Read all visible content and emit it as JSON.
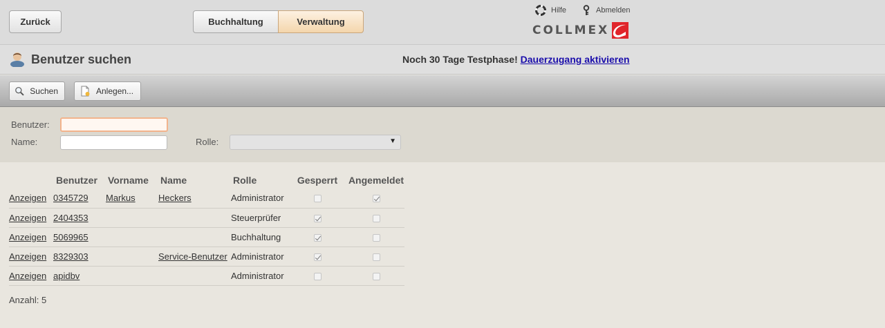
{
  "topbar": {
    "back_label": "Zurück",
    "tabs": [
      {
        "label": "Buchhaltung",
        "active": false
      },
      {
        "label": "Verwaltung",
        "active": true
      }
    ],
    "help_label": "Hilfe",
    "logout_label": "Abmelden",
    "logo_text": "COLLMEX",
    "logo_color": "#e0252b"
  },
  "titlebar": {
    "title": "Benutzer suchen",
    "trial_text": "Noch 30 Tage Testphase!",
    "trial_link": "Dauerzugang aktivieren"
  },
  "toolbar": {
    "search_label": "Suchen",
    "new_label": "Anlegen..."
  },
  "filter": {
    "user_label": "Benutzer:",
    "user_value": "",
    "name_label": "Name:",
    "name_value": "",
    "role_label": "Rolle:",
    "role_value": ""
  },
  "table": {
    "columns": [
      "Benutzer",
      "Vorname",
      "Name",
      "Rolle",
      "Gesperrt",
      "Angemeldet"
    ],
    "rows": [
      {
        "action": "Anzeigen",
        "user": "0345729",
        "first": "Markus",
        "last": "Heckers",
        "role": "Administrator",
        "locked": false,
        "logged_in": true
      },
      {
        "action": "Anzeigen",
        "user": "2404353",
        "first": "",
        "last": "",
        "role": "Steuerprüfer",
        "locked": true,
        "logged_in": false
      },
      {
        "action": "Anzeigen",
        "user": "5069965",
        "first": "",
        "last": "",
        "role": "Buchhaltung",
        "locked": true,
        "logged_in": false
      },
      {
        "action": "Anzeigen",
        "user": "8329303",
        "first": "",
        "last": "Service-Benutzer",
        "role": "Administrator",
        "locked": true,
        "logged_in": false
      },
      {
        "action": "Anzeigen",
        "user": "apidbv",
        "first": "",
        "last": "",
        "role": "Administrator",
        "locked": false,
        "logged_in": false
      }
    ],
    "count_text": "Anzahl: 5"
  }
}
